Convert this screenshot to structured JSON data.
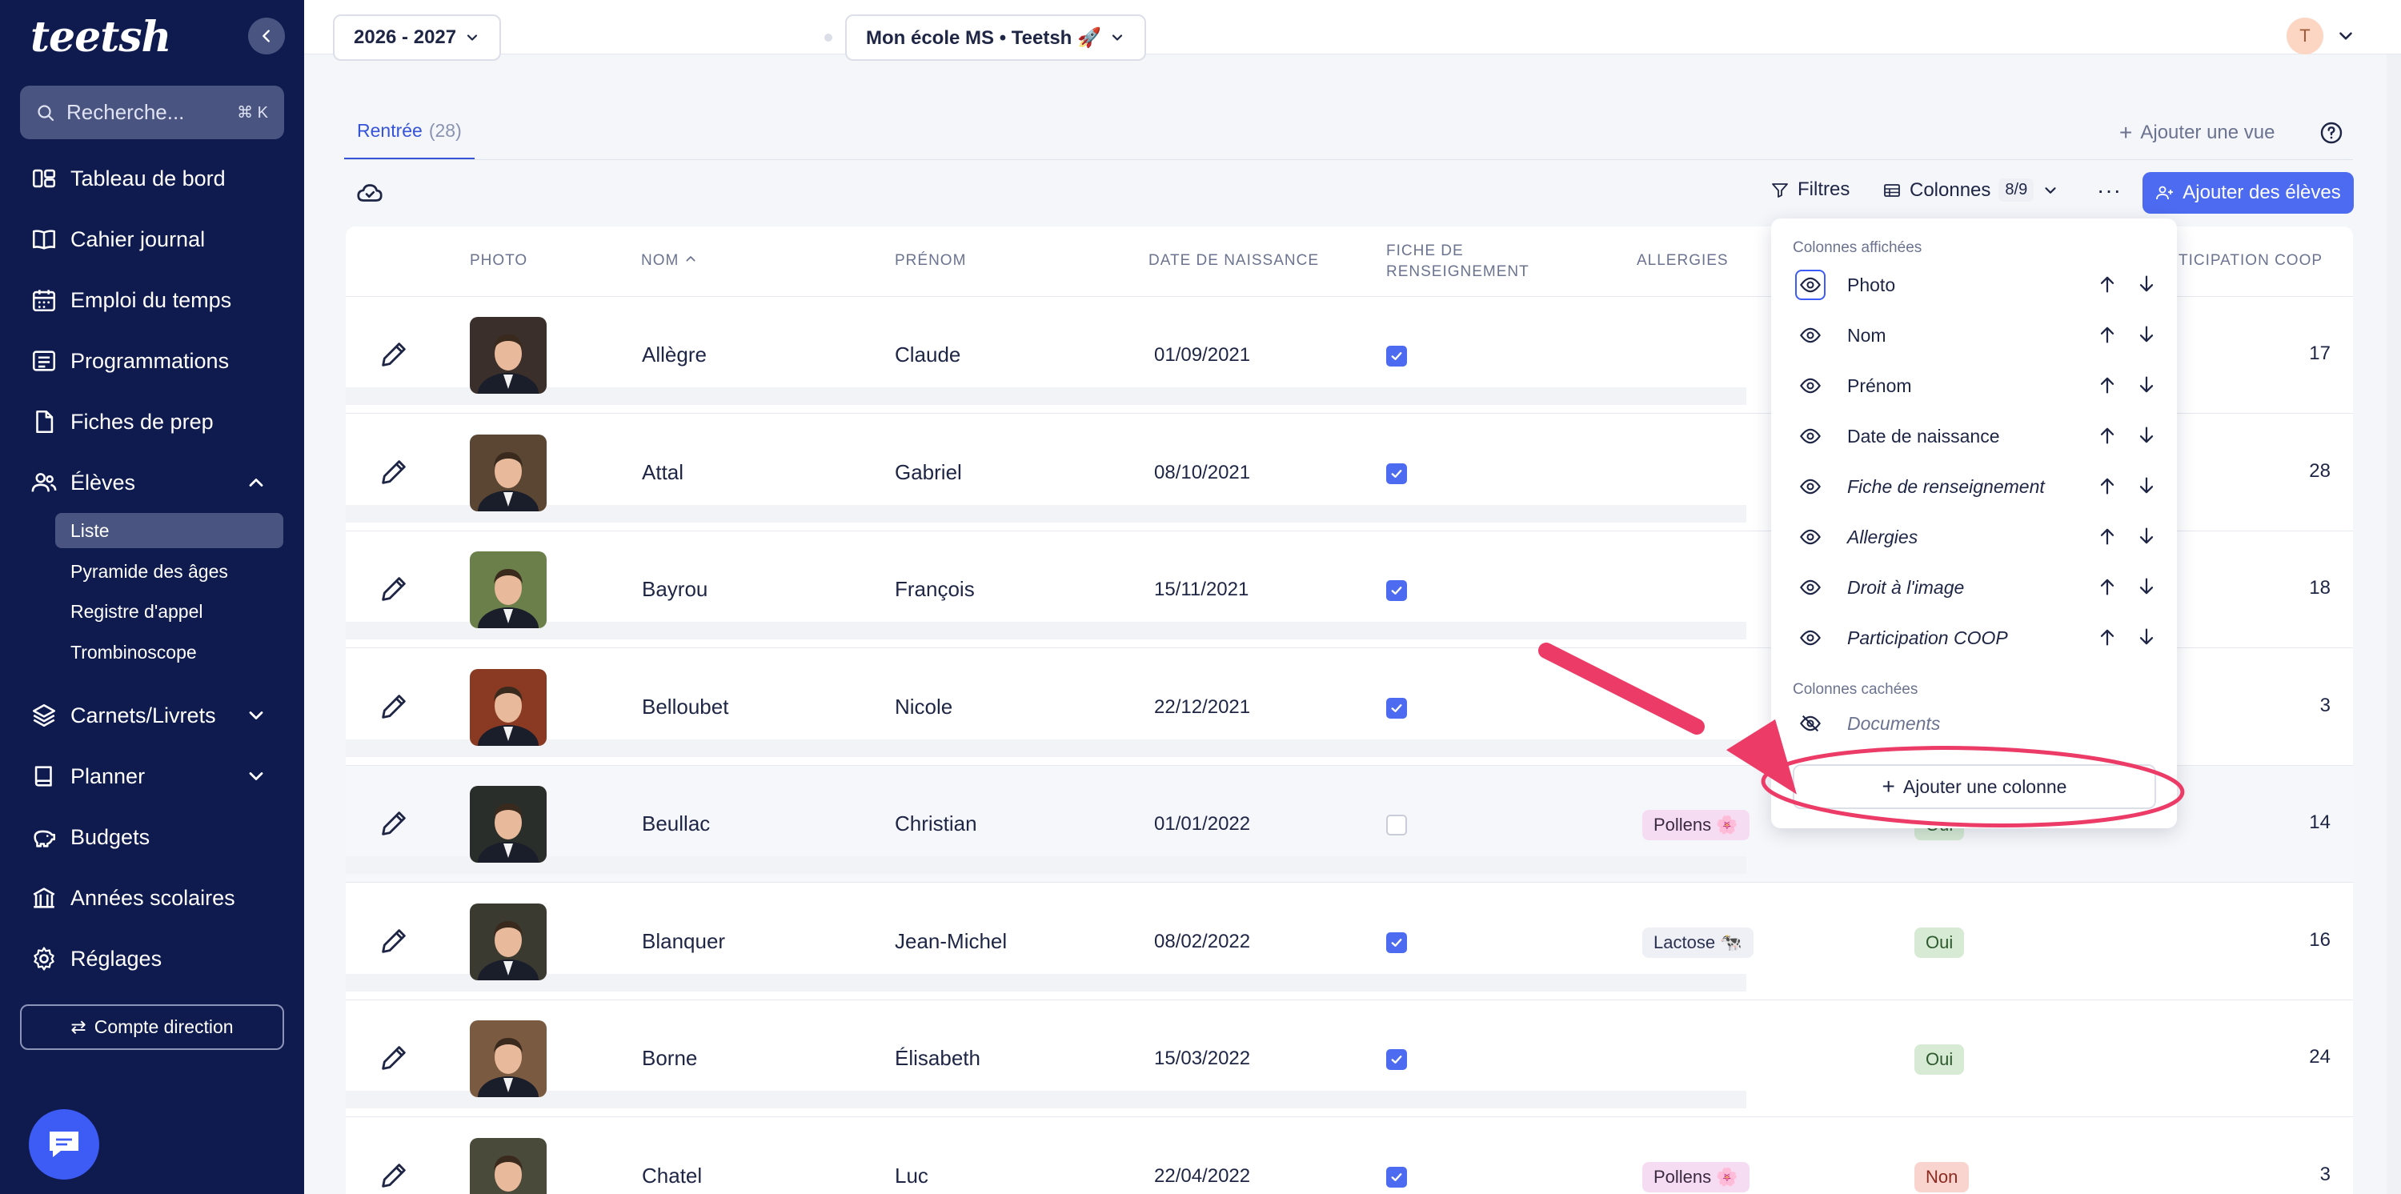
{
  "sidebar": {
    "logo": "teetsh",
    "search_placeholder": "Recherche...",
    "search_shortcut": "⌘ K",
    "nav": {
      "tableau": "Tableau de bord",
      "cahier": "Cahier journal",
      "emploi": "Emploi du temps",
      "programmations": "Programmations",
      "fiches": "Fiches de prep",
      "eleves": "Élèves",
      "carnets": "Carnets/Livrets",
      "planner": "Planner",
      "budgets": "Budgets",
      "annees": "Années scolaires",
      "reglages": "Réglages"
    },
    "eleves_sub": {
      "liste": "Liste",
      "pyramide": "Pyramide des âges",
      "registre": "Registre d'appel",
      "trombinoscope": "Trombinoscope"
    },
    "compte_label": "Compte direction"
  },
  "topbar": {
    "year_label": "2026 - 2027",
    "school_label": "Mon école MS • Teetsh 🚀",
    "avatar_initial": "T"
  },
  "view": {
    "tab_label": "Rentrée",
    "tab_count": "(28)",
    "add_view": "Ajouter une vue"
  },
  "toolbar": {
    "filtres": "Filtres",
    "colonnes": "Colonnes",
    "colonnes_count": "8/9",
    "more": "···",
    "add_students": "Ajouter des élèves"
  },
  "table": {
    "headers": {
      "photo": "PHOTO",
      "nom": "NOM",
      "prenom": "PRÉNOM",
      "naissance": "DATE DE NAISSANCE",
      "fiche_l1": "FICHE DE",
      "fiche_l2": "RENSEIGNEMENT",
      "allergies": "ALLERGIES",
      "coop": "TICIPATION COOP"
    },
    "rows": [
      {
        "nom": "Allègre",
        "prenom": "Claude",
        "naissance": "01/09/2021",
        "fiche": true,
        "allergie": "",
        "droit": "",
        "coop": "17",
        "photo_color": "#3a2f2a"
      },
      {
        "nom": "Attal",
        "prenom": "Gabriel",
        "naissance": "08/10/2021",
        "fiche": true,
        "allergie": "",
        "droit": "",
        "coop": "28",
        "photo_color": "#5a4632"
      },
      {
        "nom": "Bayrou",
        "prenom": "François",
        "naissance": "15/11/2021",
        "fiche": true,
        "allergie": "",
        "droit": "",
        "coop": "18",
        "photo_color": "#6b7f4a"
      },
      {
        "nom": "Belloubet",
        "prenom": "Nicole",
        "naissance": "22/12/2021",
        "fiche": true,
        "allergie": "",
        "droit": "",
        "coop": "3",
        "photo_color": "#8a3a22"
      },
      {
        "nom": "Beullac",
        "prenom": "Christian",
        "naissance": "01/01/2022",
        "fiche": false,
        "allergie": "Pollens 🌸",
        "droit": "Oui",
        "coop": "14",
        "photo_color": "#2a2e2a"
      },
      {
        "nom": "Blanquer",
        "prenom": "Jean-Michel",
        "naissance": "08/02/2022",
        "fiche": true,
        "allergie": "Lactose 🐄",
        "droit": "Oui",
        "coop": "16",
        "photo_color": "#3b3a30"
      },
      {
        "nom": "Borne",
        "prenom": "Élisabeth",
        "naissance": "15/03/2022",
        "fiche": true,
        "allergie": "",
        "droit": "Oui",
        "coop": "24",
        "photo_color": "#7a5a40"
      },
      {
        "nom": "Chatel",
        "prenom": "Luc",
        "naissance": "22/04/2022",
        "fiche": true,
        "allergie": "Pollens 🌸",
        "droit": "Non",
        "coop": "3",
        "photo_color": "#4a4a3a"
      }
    ]
  },
  "dropdown": {
    "shown_title": "Colonnes affichées",
    "hidden_title": "Colonnes cachées",
    "shown": [
      {
        "label": "Photo",
        "italic": false,
        "selected": true
      },
      {
        "label": "Nom",
        "italic": false,
        "selected": false
      },
      {
        "label": "Prénom",
        "italic": false,
        "selected": false
      },
      {
        "label": "Date de naissance",
        "italic": false,
        "selected": false
      },
      {
        "label": "Fiche de renseignement",
        "italic": true,
        "selected": false
      },
      {
        "label": "Allergies",
        "italic": true,
        "selected": false
      },
      {
        "label": "Droit à l'image",
        "italic": true,
        "selected": false
      },
      {
        "label": "Participation COOP",
        "italic": true,
        "selected": false
      }
    ],
    "hidden": [
      {
        "label": "Documents"
      }
    ],
    "add_column": "Ajouter une colonne"
  },
  "colors": {
    "sidebar_bg": "#0f1a4f",
    "accent": "#4d6bf0",
    "annotation": "#ec3b66"
  }
}
